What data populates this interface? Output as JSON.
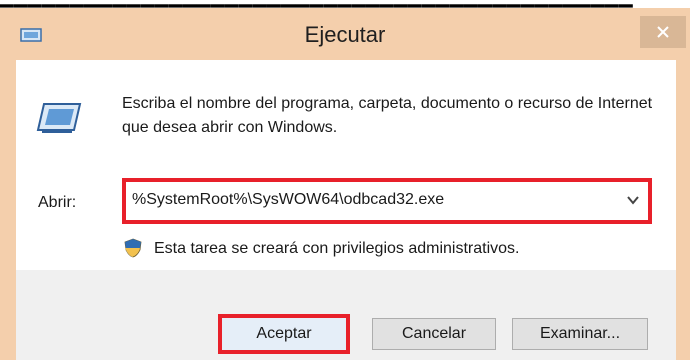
{
  "window": {
    "title": "Ejecutar",
    "close_glyph": "✕",
    "app_icon": "run-icon"
  },
  "content": {
    "description": "Escriba el nombre del programa, carpeta, documento o recurso de Internet que desea abrir con Windows.",
    "open_label": "Abrir:",
    "open_value": "%SystemRoot%\\SysWOW64\\odbcad32.exe",
    "admin_note": "Esta tarea se creará con privilegios administrativos."
  },
  "buttons": {
    "ok": "Aceptar",
    "cancel": "Cancelar",
    "browse": "Examinar..."
  },
  "colors": {
    "titlebar": "#f4cfac",
    "highlight": "#e8202a"
  }
}
